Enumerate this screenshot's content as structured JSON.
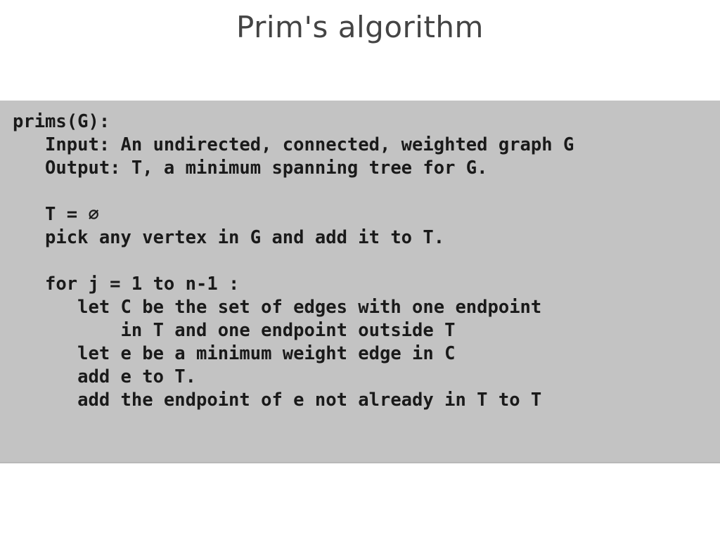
{
  "slide": {
    "title": "Prim's algorithm",
    "background_color": "#ffffff",
    "title_color": "#444444"
  },
  "code_panel": {
    "background_color": "#c3c3c3",
    "text_color": "#1a1a1a",
    "lines": [
      {
        "id": "line-signature",
        "text": "prims(G):"
      },
      {
        "id": "line-input",
        "text": "   Input: An undirected, connected, weighted graph G"
      },
      {
        "id": "line-output",
        "text": "   Output: T, a minimum spanning tree for G."
      },
      {
        "id": "line-blank-1",
        "text": ""
      },
      {
        "id": "line-init-t",
        "text": "   T = ∅"
      },
      {
        "id": "line-pick-vertex",
        "text": "   pick any vertex in G and add it to T."
      },
      {
        "id": "line-blank-2",
        "text": ""
      },
      {
        "id": "line-for-loop",
        "text": "   for j = 1 to n-1 :"
      },
      {
        "id": "line-let-c",
        "text": "      let C be the set of edges with one endpoint"
      },
      {
        "id": "line-let-c-cont",
        "text": "          in T and one endpoint outside T"
      },
      {
        "id": "line-let-e",
        "text": "      let e be a minimum weight edge in C"
      },
      {
        "id": "line-add-e",
        "text": "      add e to T."
      },
      {
        "id": "line-add-endpoint",
        "text": "      add the endpoint of e not already in T to T"
      }
    ]
  }
}
